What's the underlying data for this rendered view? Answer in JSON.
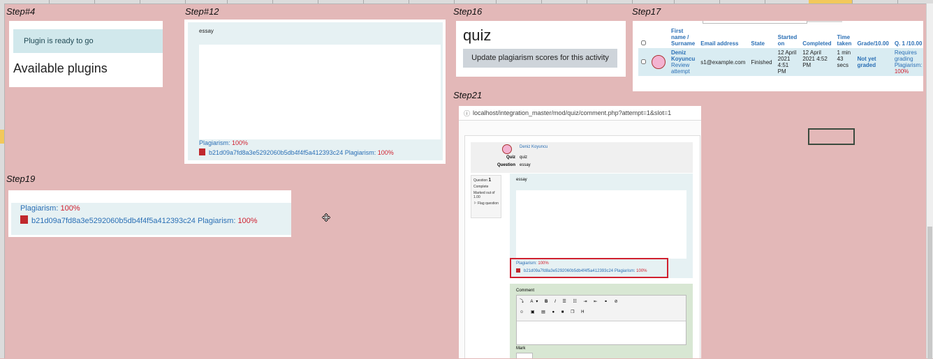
{
  "steps": {
    "s4": "Step#4",
    "s12": "Step#12",
    "s16": "Step16",
    "s17": "Step17",
    "s19": "Step19",
    "s21": "Step21"
  },
  "step4": {
    "ready": "Plugin is ready to go",
    "heading": "Available plugins"
  },
  "step12": {
    "question": "essay",
    "plag_label": "Plagiarism:",
    "plag_value": "100%",
    "file_name": "b21d09a7fd8a3e5292060b5db4f4f5a412393c24",
    "file_plag_label": "Plagiarism:",
    "file_plag_value": "100%"
  },
  "step16": {
    "title": "quiz",
    "button": "Update plagiarism scores for this activity"
  },
  "step17": {
    "headers": {
      "name": "First name / Surname",
      "email": "Email address",
      "state": "State",
      "started": "Started on",
      "completed": "Completed",
      "time": "Time taken",
      "grade": "Grade/10.00",
      "q1": "Q. 1 /10.00"
    },
    "row": {
      "name": "Deniz Koyuncu",
      "review": "Review attempt",
      "email": "s1@example.com",
      "state": "Finished",
      "started": "12 April 2021 4:51 PM",
      "completed": "12 April 2021 4:52 PM",
      "time": "1 min 43 secs",
      "grade": "Not yet graded",
      "q1": "Requires grading",
      "q1_plag": "Plagiarism:",
      "q1_plag_value": "100%"
    }
  },
  "step19": {
    "plag_label": "Plagiarism:",
    "plag_value": "100%",
    "file_name": "b21d09a7fd8a3e5292060b5db4f4f5a412393c24",
    "file_plag_label": "Plagiarism:",
    "file_plag_value": "100%"
  },
  "step21": {
    "url": "localhost/integration_master/mod/quiz/comment.php?attempt=1&slot=1",
    "user": "Deniz Koyuncu",
    "quiz_label": "Quiz",
    "quiz_value": "quiz",
    "question_label": "Question",
    "question_value": "essay",
    "qinfo_title": "Question",
    "qinfo_num": "1",
    "qinfo_status": "Complete",
    "qinfo_marked": "Marked out of 1.00",
    "qinfo_flag": "Flag question",
    "essay": "essay",
    "plag_label": "Plagiarism:",
    "plag_value": "100%",
    "file_name": "b21d09a7fd8a3e5292060b5db4f4f5a412393c24",
    "file_plag_label": "Plagiarism:",
    "file_plag_value": "100%",
    "comment_label": "Comment",
    "mark_label": "Mark"
  }
}
